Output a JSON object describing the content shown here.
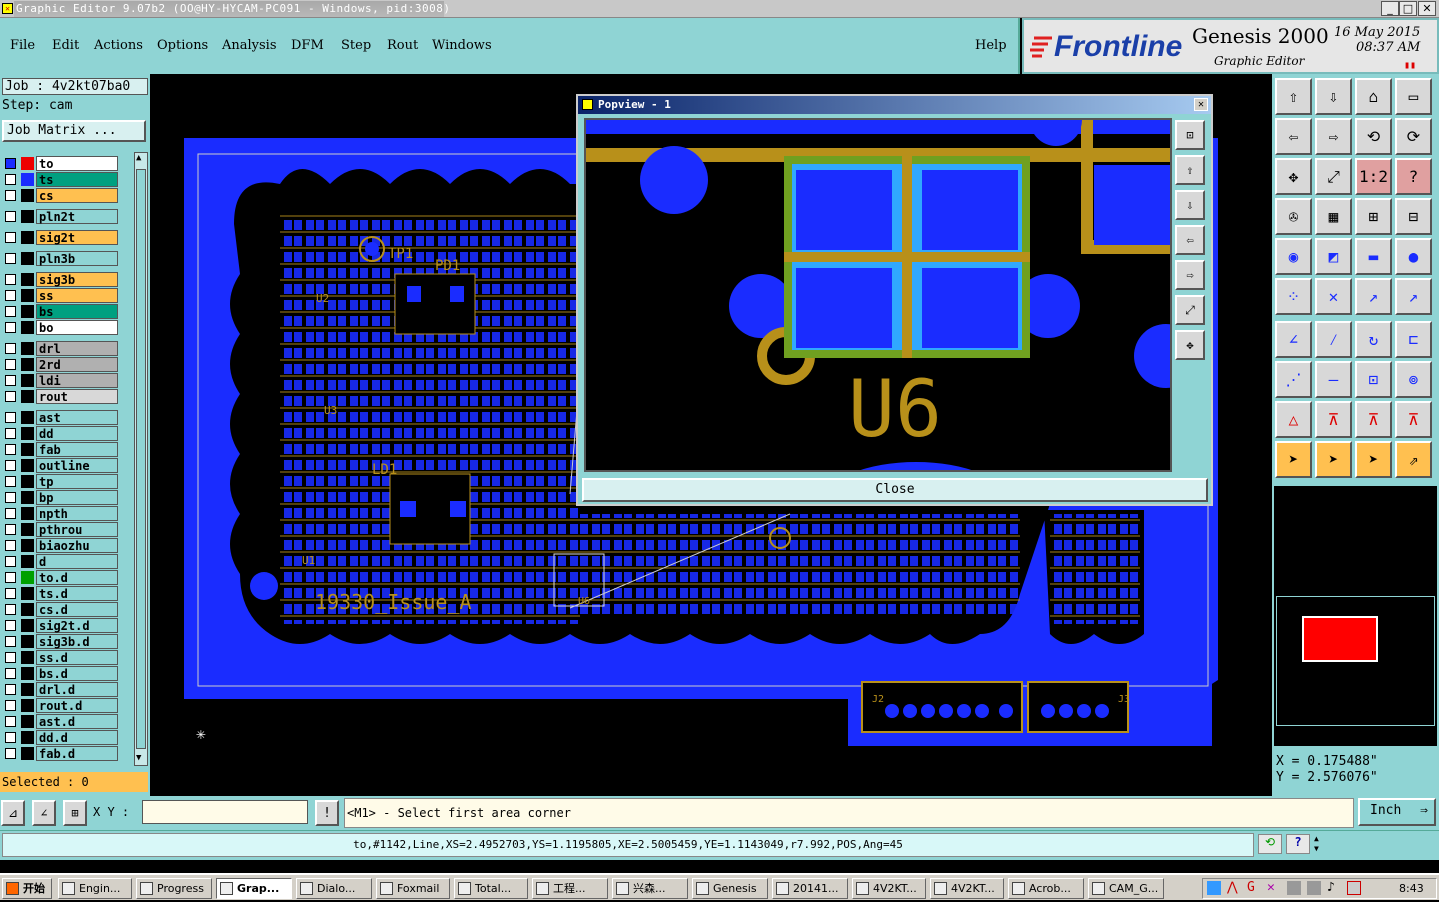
{
  "title": "Graphic Editor 9.07b2 (OO@HY-HYCAM-PC091 - Windows, pid:3008)",
  "menu": [
    "File",
    "Edit",
    "Actions",
    "Options",
    "Analysis",
    "DFM",
    "Step",
    "Rout",
    "Windows"
  ],
  "help": "Help",
  "logo": {
    "brand": "Frontline",
    "product": "Genesis 2000",
    "sub": "Graphic Editor",
    "date": "16 May 2015",
    "time": "08:37 AM"
  },
  "job": "Job : 4v2kt07ba0",
  "step": "Step: cam",
  "job_matrix": "Job Matrix ...",
  "selected": "Selected : 0",
  "layers": [
    {
      "name": "to",
      "color": "#ffffff"
    },
    {
      "name": "ts",
      "color": "#00a080"
    },
    {
      "name": "cs",
      "color": "#ffc050"
    },
    {
      "name": "pln2t",
      "color": "#8fd4d4"
    },
    {
      "name": "sig2t",
      "color": "#ffc050"
    },
    {
      "name": "pln3b",
      "color": "#8fd4d4"
    },
    {
      "name": "sig3b",
      "color": "#ffc050"
    },
    {
      "name": "ss",
      "color": "#ffc050"
    },
    {
      "name": "bs",
      "color": "#00a080"
    },
    {
      "name": "bo",
      "color": "#ffffff"
    },
    {
      "name": "drl",
      "color": "#b0b0b0"
    },
    {
      "name": "2rd",
      "color": "#b0b0b0"
    },
    {
      "name": "ldi",
      "color": "#b0b0b0"
    },
    {
      "name": "rout",
      "color": "#d8d8d8"
    },
    {
      "name": "ast",
      "color": "#8fd4d4"
    },
    {
      "name": "dd",
      "color": "#8fd4d4"
    },
    {
      "name": "fab",
      "color": "#8fd4d4"
    },
    {
      "name": "outline",
      "color": "#8fd4d4"
    },
    {
      "name": "tp",
      "color": "#8fd4d4"
    },
    {
      "name": "bp",
      "color": "#8fd4d4"
    },
    {
      "name": "npth",
      "color": "#8fd4d4"
    },
    {
      "name": "pthrou",
      "color": "#8fd4d4"
    },
    {
      "name": "biaozhu",
      "color": "#8fd4d4"
    },
    {
      "name": "d",
      "color": "#8fd4d4"
    },
    {
      "name": "to.d",
      "color": "#8fd4d4"
    },
    {
      "name": "ts.d",
      "color": "#8fd4d4"
    },
    {
      "name": "cs.d",
      "color": "#8fd4d4"
    },
    {
      "name": "sig2t.d",
      "color": "#8fd4d4"
    },
    {
      "name": "sig3b.d",
      "color": "#8fd4d4"
    },
    {
      "name": "ss.d",
      "color": "#8fd4d4"
    },
    {
      "name": "bs.d",
      "color": "#8fd4d4"
    },
    {
      "name": "drl.d",
      "color": "#8fd4d4"
    },
    {
      "name": "rout.d",
      "color": "#8fd4d4"
    },
    {
      "name": "ast.d",
      "color": "#8fd4d4"
    },
    {
      "name": "dd.d",
      "color": "#8fd4d4"
    },
    {
      "name": "fab.d",
      "color": "#8fd4d4"
    }
  ],
  "popview": {
    "title": "Popview - 1",
    "label": "U6",
    "close": "Close"
  },
  "board": {
    "label": "19330_Issue_A",
    "tp": "TP1",
    "pd": "PD1",
    "ld": "LD1",
    "u6": "U6",
    "u2": "U2",
    "u3": "U3",
    "u1": "U1",
    "j2": "J2",
    "j3": "J3"
  },
  "coords": {
    "x": "X = 0.175488\"",
    "y": "Y = 2.576076\""
  },
  "xy_label": "X Y :",
  "prompt": "<M1> - Select first area corner",
  "units": "Inch",
  "status": "to,#1142,Line,XS=2.4952703,YS=1.1195805,XE=2.5005459,YE=1.1143049,r7.992,POS,Ang=45",
  "taskbar": {
    "start": "开始",
    "clock": "8:43",
    "tasks": [
      "Engin...",
      "Progress",
      "Grap...",
      "Dialo...",
      "Foxmail",
      "Total...",
      "工程...",
      "兴森...",
      "Genesis",
      "20141...",
      "4V2KT...",
      "4V2KT...",
      "Acrob...",
      "CAM_G..."
    ]
  }
}
